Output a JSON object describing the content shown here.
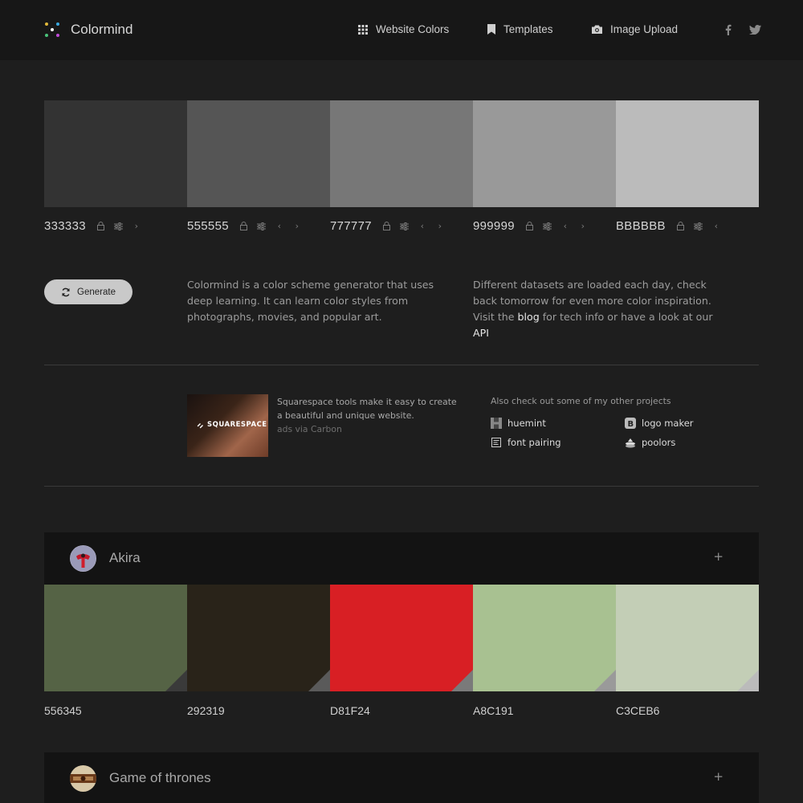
{
  "header": {
    "brand": "Colormind",
    "nav": [
      {
        "label": "Website Colors",
        "icon": "grid-icon"
      },
      {
        "label": "Templates",
        "icon": "bookmark-icon"
      },
      {
        "label": "Image Upload",
        "icon": "camera-icon"
      }
    ],
    "social": [
      "facebook-icon",
      "twitter-icon"
    ]
  },
  "palette": [
    {
      "hex": "333333",
      "color": "#333333"
    },
    {
      "hex": "555555",
      "color": "#555555"
    },
    {
      "hex": "777777",
      "color": "#777777"
    },
    {
      "hex": "999999",
      "color": "#999999"
    },
    {
      "hex": "BBBBBB",
      "color": "#BBBBBB"
    }
  ],
  "generate_label": "Generate",
  "intro": {
    "text": "Colormind is a color scheme generator that uses deep learning. It can learn color styles from photographs, movies, and popular art."
  },
  "datasets": {
    "text_before": "Different datasets are loaded each day, check back tomorrow for even more color inspiration. Visit the ",
    "blog_link": "blog",
    "text_middle": " for tech info or have a look at our ",
    "api_link": "API"
  },
  "ad": {
    "image_text": "SQUARESPACE",
    "text": "Squarespace tools make it easy to create a beautiful and unique website.",
    "via": "ads via Carbon"
  },
  "projects": {
    "title": "Also check out some of my other projects",
    "items": [
      {
        "label": "huemint"
      },
      {
        "label": "logo maker"
      },
      {
        "label": "font pairing"
      },
      {
        "label": "poolors"
      }
    ]
  },
  "collections": [
    {
      "name": "Akira",
      "colors": [
        {
          "hex": "556345",
          "color": "#556345"
        },
        {
          "hex": "292319",
          "color": "#292319"
        },
        {
          "hex": "D81F24",
          "color": "#D81F24"
        },
        {
          "hex": "A8C191",
          "color": "#A8C191"
        },
        {
          "hex": "C3CEB6",
          "color": "#C3CEB6"
        }
      ]
    },
    {
      "name": "Game of thrones"
    }
  ]
}
